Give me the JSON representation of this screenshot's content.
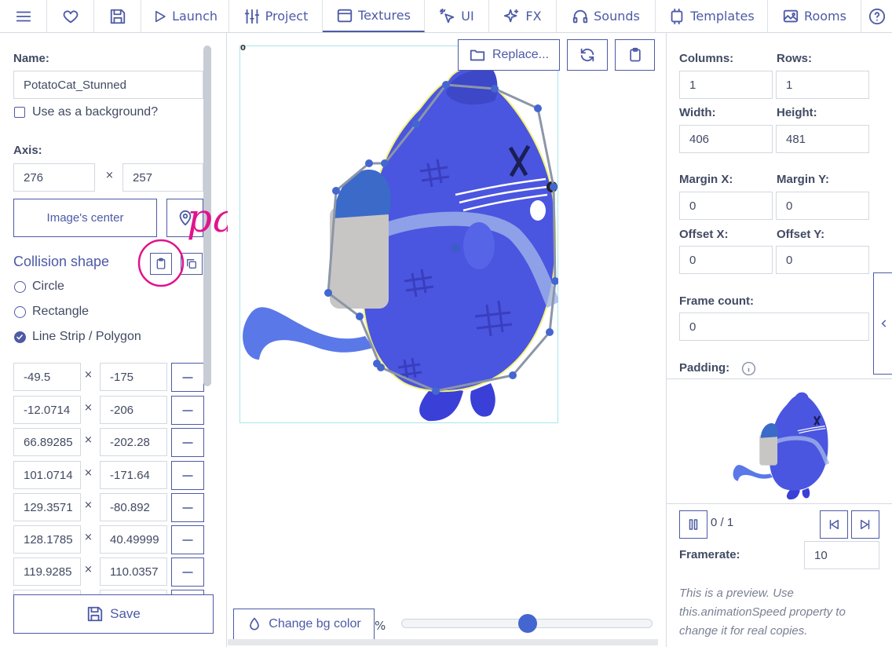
{
  "topbar": {
    "tabs": [
      {
        "icon": "menu-icon",
        "label": ""
      },
      {
        "icon": "heart-icon",
        "label": ""
      },
      {
        "icon": "save-icon",
        "label": ""
      },
      {
        "icon": "play-icon",
        "label": "Launch"
      },
      {
        "icon": "sliders-icon",
        "label": "Project"
      },
      {
        "icon": "image-icon",
        "label": "Textures"
      },
      {
        "icon": "cursor-icon",
        "label": "UI"
      },
      {
        "icon": "sparkles-icon",
        "label": "FX"
      },
      {
        "icon": "headphones-icon",
        "label": "Sounds"
      },
      {
        "icon": "plugin-icon",
        "label": "Templates"
      },
      {
        "icon": "picture-icon",
        "label": "Rooms"
      },
      {
        "icon": "help-icon",
        "label": ""
      }
    ],
    "active_tab": "Textures"
  },
  "left": {
    "name_label": "Name:",
    "name_value": "PotatoCat_Stunned",
    "background_label": "Use as a background?",
    "axis_label": "Axis:",
    "axis_x": "276",
    "axis_y": "257",
    "times": "×",
    "center_button": "Image's center",
    "collision_title": "Collision shape",
    "annotation": "paste",
    "shapes": [
      "Circle",
      "Rectangle",
      "Line Strip / Polygon"
    ],
    "selected_shape": "Line Strip / Polygon",
    "points": [
      [
        "-49.5",
        "-175"
      ],
      [
        "-12.0714",
        "-206"
      ],
      [
        "66.89285",
        "-202.28"
      ],
      [
        "101.0714",
        "-171.64"
      ],
      [
        "129.3571",
        "-80.892"
      ],
      [
        "128.1785",
        "40.49999"
      ],
      [
        "119.9285",
        "110.0357"
      ],
      [
        "",
        ""
      ]
    ],
    "save_label": "Save"
  },
  "center": {
    "replace_label": "Replace...",
    "bg_color_label": "Change bg color",
    "zoom_suffix": "%",
    "zoom_slider_fraction": 0.5
  },
  "right": {
    "columns_label": "Columns:",
    "rows_label": "Rows:",
    "columns": "1",
    "rows": "1",
    "width_label": "Width:",
    "height_label": "Height:",
    "width": "406",
    "height": "481",
    "marginx_label": "Margin X:",
    "marginy_label": "Margin Y:",
    "marginx": "0",
    "marginy": "0",
    "offsetx_label": "Offset X:",
    "offsety_label": "Offset Y:",
    "offsetx": "0",
    "offsety": "0",
    "framecount_label": "Frame count:",
    "framecount": "0",
    "padding_label": "Padding:",
    "frame_status": "0 / 1",
    "framerate_label": "Framerate:",
    "framerate": "10",
    "note": "This is a preview. Use this.animationSpeed property to change it for real copies."
  },
  "colors": {
    "accent": "#4d5aa6",
    "cat": "#4a55e0",
    "annotation": "#e0148c",
    "handle": "#4466d0"
  }
}
